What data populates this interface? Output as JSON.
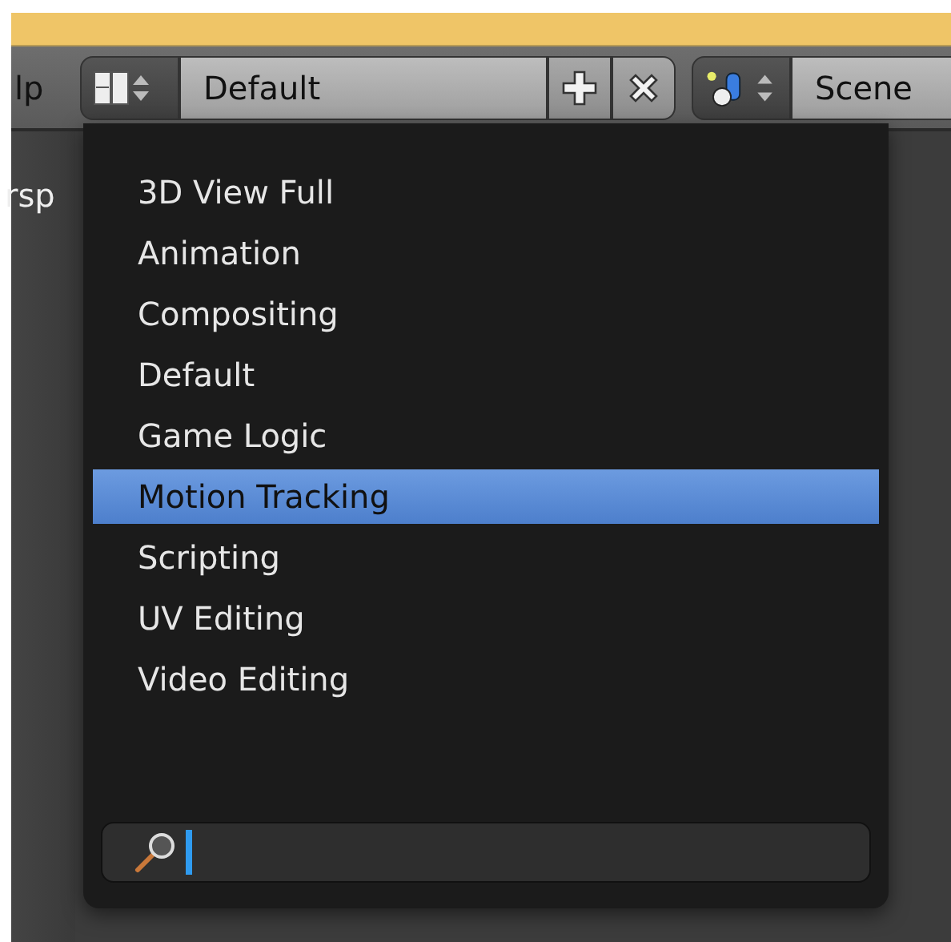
{
  "header": {
    "menu_label": "lp",
    "layout_name": "Default",
    "scene_name": "Scene"
  },
  "viewport": {
    "label": "rsp"
  },
  "layout_menu": {
    "items": [
      {
        "label": "3D View Full",
        "selected": false
      },
      {
        "label": "Animation",
        "selected": false
      },
      {
        "label": "Compositing",
        "selected": false
      },
      {
        "label": "Default",
        "selected": false
      },
      {
        "label": "Game Logic",
        "selected": false
      },
      {
        "label": "Motion Tracking",
        "selected": true
      },
      {
        "label": "Scripting",
        "selected": false
      },
      {
        "label": "UV Editing",
        "selected": false
      },
      {
        "label": "Video Editing",
        "selected": false
      }
    ]
  }
}
